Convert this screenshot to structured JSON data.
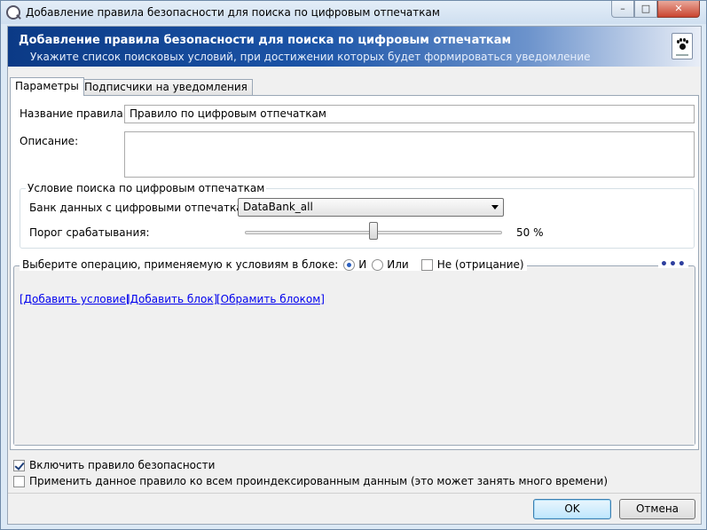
{
  "window": {
    "title": "Добавление правила безопасности для поиска по цифровым отпечаткам",
    "controls": {
      "minimize": "–",
      "maximize": "□",
      "close": "✕"
    }
  },
  "banner": {
    "title": "Добавление правила безопасности для поиска по цифровым отпечаткам",
    "subtitle": "Укажите список поисковых условий, при достижении которых будет формироваться уведомление",
    "logo_icon": "paw-print-icon"
  },
  "tabs": [
    {
      "label": "Параметры",
      "active": true
    },
    {
      "label": "Подписчики на уведомления",
      "active": false
    }
  ],
  "form": {
    "rule_name_label": "Название правила:",
    "rule_name_value": "Правило по цифровым отпечаткам",
    "description_label": "Описание:",
    "description_value": ""
  },
  "fingerprint_group": {
    "title": "Условие поиска по цифровым отпечаткам",
    "databank_label": "Банк данных с цифровыми отпечатками:",
    "databank_value": "DataBank_all",
    "threshold_label": "Порог срабатывания:",
    "threshold_percent": 50,
    "threshold_text": "50 %"
  },
  "operation": {
    "prompt": "Выберите операцию, применяемую к условиям в блоке:",
    "options": [
      "И",
      "Или"
    ],
    "selected": "И",
    "negation_label": "Не (отрицание)",
    "negation_checked": false,
    "more_icon": "ellipsis-icon",
    "more_text": "•••",
    "links": [
      "[Добавить условие]",
      "[Добавить блок]",
      "[Обрамить блоком]"
    ]
  },
  "options": {
    "enable_rule_label": "Включить правило безопасности",
    "enable_rule_checked": true,
    "apply_all_label": "Применить данное правило ко всем проиндексированным данным (это может занять много времени)",
    "apply_all_checked": false
  },
  "buttons": {
    "ok": "OK",
    "cancel": "Отмена"
  }
}
